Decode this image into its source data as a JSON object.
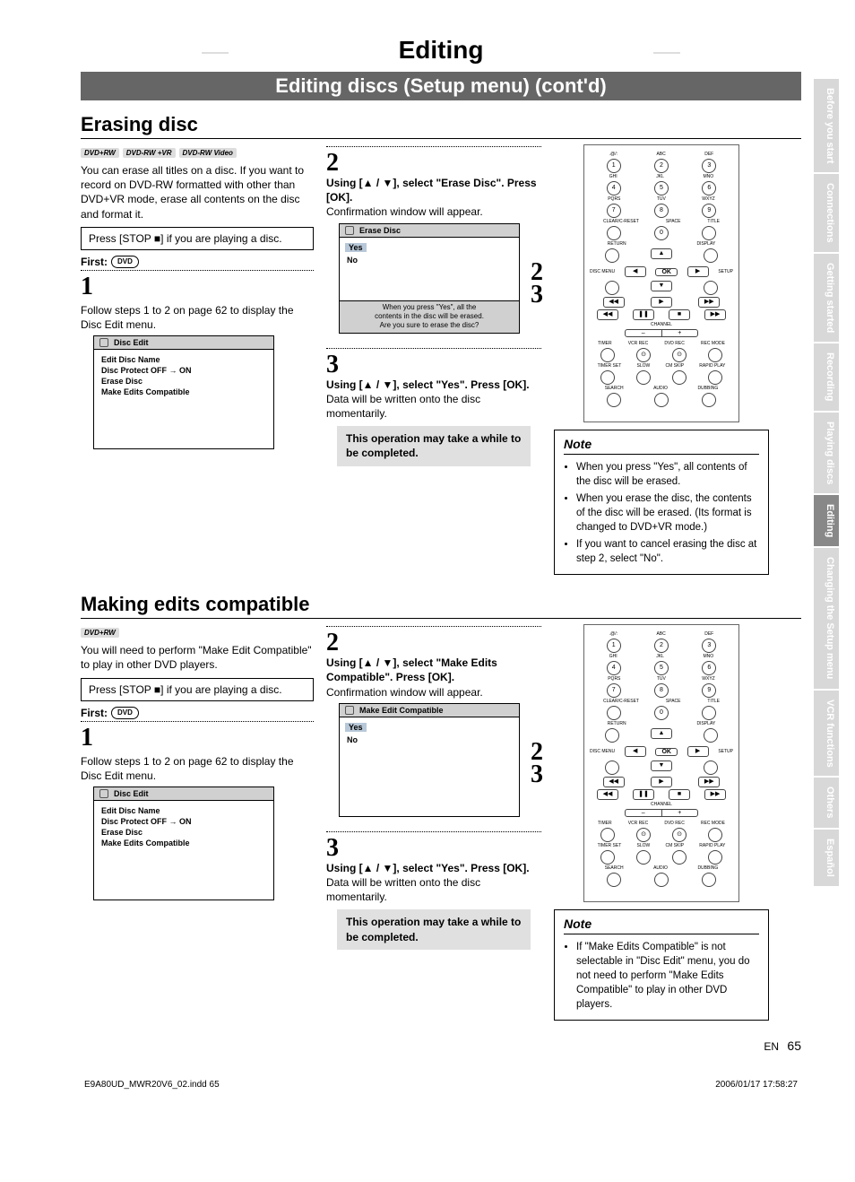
{
  "header": {
    "title": "Editing",
    "subtitle": "Editing discs (Setup menu) (cont'd)"
  },
  "tabs": {
    "items": [
      "Before you start",
      "Connections",
      "Getting started",
      "Recording",
      "Playing discs",
      "Editing",
      "Changing the Setup menu",
      "VCR functions",
      "Others",
      "Español"
    ],
    "activeIndex": 5
  },
  "erase": {
    "sectionTitle": "Erasing disc",
    "badges": [
      "DVD+RW",
      "DVD-RW +VR",
      "DVD-RW Video"
    ],
    "intro": "You can erase all titles on a disc. If you want to record on DVD-RW formatted with other than DVD+VR mode, erase all contents on the disc and format it.",
    "pressStop": "Press [STOP ■] if you are playing a disc.",
    "firstLabel": "First:",
    "dvdPill": "DVD",
    "step1Num": "1",
    "step1Text": "Follow steps 1 to 2 on page 62 to display the Disc Edit menu.",
    "discEditBox": {
      "title": "Disc Edit",
      "items": [
        "Edit Disc Name",
        "Disc Protect OFF → ON",
        "Erase Disc",
        "Make Edits Compatible"
      ]
    },
    "step2Num": "2",
    "step2Bold": "Using [▲ / ▼], select \"Erase Disc\". Press [OK].",
    "step2Plain": "Confirmation window will appear.",
    "eraseBox": {
      "title": "Erase Disc",
      "yes": "Yes",
      "no": "No",
      "footer1": "When you press \"Yes\", all the",
      "footer2": "contents in the disc will be erased.",
      "footer3": "Are you sure to erase the disc?"
    },
    "step3Num": "3",
    "step3Bold": "Using [▲ / ▼], select \"Yes\". Press [OK].",
    "step3Plain": "Data will be written onto the disc momentarily.",
    "callout": "This operation may take a while to be completed.",
    "big2": "2",
    "big3": "3",
    "noteTitle": "Note",
    "noteItems": [
      "When you press \"Yes\", all contents of the disc will be erased.",
      "When you erase the disc, the contents of the disc will be erased. (Its format is changed to DVD+VR mode.)",
      "If you want to cancel erasing the disc at step 2, select \"No\"."
    ]
  },
  "compat": {
    "sectionTitle": "Making edits compatible",
    "badges": [
      "DVD+RW"
    ],
    "intro": "You will need to perform \"Make Edit Compatible\" to play in other DVD players.",
    "pressStop": "Press [STOP ■] if you are playing a disc.",
    "firstLabel": "First:",
    "dvdPill": "DVD",
    "step1Num": "1",
    "step1Text": "Follow steps 1 to 2 on page 62 to display the Disc Edit menu.",
    "discEditBox": {
      "title": "Disc Edit",
      "items": [
        "Edit Disc Name",
        "Disc Protect OFF → ON",
        "Erase Disc",
        "Make Edits Compatible"
      ]
    },
    "step2Num": "2",
    "step2Bold": "Using [▲ / ▼], select \"Make Edits Compatible\". Press [OK].",
    "step2Plain": "Confirmation window will appear.",
    "compatBox": {
      "title": "Make Edit Compatible",
      "yes": "Yes",
      "no": "No"
    },
    "step3Num": "3",
    "step3Bold": "Using [▲ / ▼], select \"Yes\". Press [OK].",
    "step3Plain": "Data will be written onto the disc momentarily.",
    "callout": "This operation may take a while to be completed.",
    "big2": "2",
    "big3": "3",
    "noteTitle": "Note",
    "noteItems": [
      "If \"Make Edits Compatible\" is not selectable in \"Disc Edit\" menu, you do not need to perform \"Make Edits Compatible\" to play in other DVD players."
    ]
  },
  "remote": {
    "row1Labels": [
      ".@/:",
      "ABC",
      "DEF"
    ],
    "row1": [
      "1",
      "2",
      "3"
    ],
    "row2Labels": [
      "GHI",
      "JKL",
      "MNO"
    ],
    "row2": [
      "4",
      "5",
      "6"
    ],
    "row3Labels": [
      "PQRS",
      "TUV",
      "WXYZ"
    ],
    "row3": [
      "7",
      "8",
      "9"
    ],
    "row4Labels": [
      "CLEAR/C-RESET",
      "SPACE",
      "TITLE"
    ],
    "row4Center": "0",
    "returnLabel": "RETURN",
    "displayLabel": "DISPLAY",
    "discMenu": "DISC MENU",
    "setup": "SETUP",
    "ok": "OK",
    "channel": "CHANNEL",
    "chMinus": "–",
    "chPlus": "+",
    "bottomLabels1": [
      "TIMER",
      "VCR REC",
      "DVD REC",
      "REC MODE"
    ],
    "bottomLabels2": [
      "TIMER SET",
      "SLOW",
      "CM SKIP",
      "RAPID PLAY"
    ],
    "bottomLabels3": [
      "SEARCH",
      "AUDIO",
      "DUBBING"
    ],
    "play": "▶",
    "stop": "■",
    "pause": "❚❚",
    "prev": "◀◀",
    "next": "▶▶",
    "rew": "◀◀",
    "ff": "▶▶",
    "up": "▲",
    "down": "▼",
    "left": "◀",
    "right": "▶"
  },
  "footer": {
    "file": "E9A80UD_MWR20V6_02.indd   65",
    "en": "EN",
    "page": "65",
    "timestamp": "2006/01/17   17:58:27"
  }
}
